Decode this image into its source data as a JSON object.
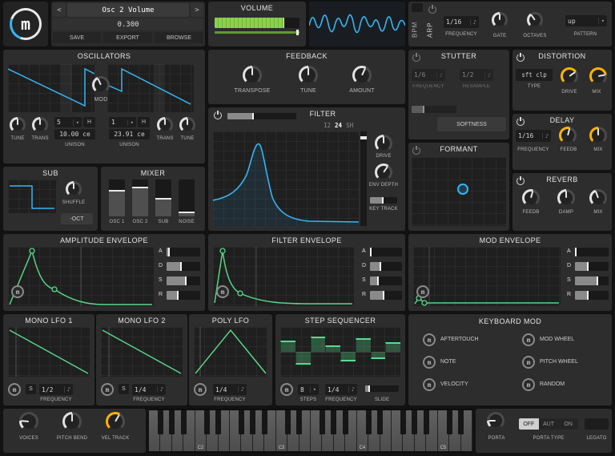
{
  "icons": {
    "helm": "m",
    "note": "♪",
    "caret": "▾",
    "prev": "<",
    "next": ">"
  },
  "colors": {
    "blue": "#35b5f3",
    "green": "#56d689",
    "orange": "#ffb300"
  },
  "top": {
    "patch": {
      "name": "Osc 2 Volume",
      "value": "0.300",
      "save": "SAVE",
      "export": "EXPORT",
      "browse": "BROWSE"
    },
    "volume_label": "VOLUME",
    "volume_fill": 0.82,
    "bpm_label": "BPM",
    "arp": {
      "label": "ARP",
      "frequency_value": "1/16",
      "frequency_label": "FREQUENCY",
      "gate_label": "GATE",
      "octaves_label": "OCTAVES",
      "pattern_value": "up",
      "pattern_label": "PATTERN"
    }
  },
  "oscillators": {
    "title": "OSCILLATORS",
    "mod_label": "MOD",
    "tune_label": "TUNE",
    "trans_label": "TRANS",
    "unison_label": "UNISON",
    "harm_label": "H",
    "osc1_voices": "5",
    "osc1_detune": "10.00 ce",
    "osc2_voices": "1",
    "osc2_detune": "23.91 ce"
  },
  "sub": {
    "title": "SUB",
    "shuffle_label": "SHUFFLE",
    "oct_label": "-OCT"
  },
  "mixer": {
    "title": "MIXER",
    "labels": [
      "OSC 1",
      "OSC 2",
      "SUB",
      "NOISE"
    ],
    "values": [
      0.72,
      0.8,
      0.5,
      0.12
    ]
  },
  "feedback": {
    "title": "FEEDBACK",
    "transpose_label": "TRANSPOSE",
    "tune_label": "TUNE",
    "amount_label": "AMOUNT"
  },
  "filter": {
    "title": "FILTER",
    "slider_fill": 0.38,
    "pole12": "12",
    "pole24": "24",
    "shelf": "SH",
    "drive_label": "DRIVE",
    "env_depth_label": "ENV DEPTH",
    "key_track_label": "KEY TRACK",
    "key_track_fill": 0.5
  },
  "stutter": {
    "title": "STUTTER",
    "frequency_value": "1/6",
    "frequency_label": "FREQUENCY",
    "resample_value": "1/2",
    "resample_label": "RESAMPLE",
    "softness_label": "SOFTNESS",
    "slider_fill": 0.28
  },
  "formant": {
    "title": "FORMANT"
  },
  "distortion": {
    "title": "DISTORTION",
    "type_value": "sft clp",
    "type_label": "TYPE",
    "drive_label": "DRIVE",
    "mix_label": "MIX"
  },
  "delay": {
    "title": "DELAY",
    "frequency_value": "1/16",
    "frequency_label": "FREQUENCY",
    "feedback_label": "FEEDB",
    "mix_label": "MIX"
  },
  "reverb": {
    "title": "REVERB",
    "feedback_label": "FEEDB",
    "damp_label": "DAMP",
    "mix_label": "MIX"
  },
  "adsr_letters": [
    "A",
    "D",
    "S",
    "R"
  ],
  "amp_env": {
    "title": "AMPLITUDE ENVELOPE",
    "adsr": [
      0.1,
      0.45,
      0.6,
      0.35
    ]
  },
  "filter_env": {
    "title": "FILTER ENVELOPE",
    "adsr": [
      0.06,
      0.35,
      0.28,
      0.45
    ]
  },
  "mod_env": {
    "title": "MOD ENVELOPE",
    "adsr": [
      0.04,
      0.4,
      0.7,
      0.4
    ]
  },
  "lfo1": {
    "title": "MONO LFO 1",
    "sync_label": "S",
    "frequency_value": "1/2",
    "frequency_label": "FREQUENCY"
  },
  "lfo2": {
    "title": "MONO LFO 2",
    "sync_label": "S",
    "frequency_value": "1/4",
    "frequency_label": "FREQUENCY"
  },
  "poly_lfo": {
    "title": "POLY LFO",
    "frequency_value": "1/4",
    "frequency_label": "FREQUENCY"
  },
  "step_sequencer": {
    "title": "STEP SEQUENCER",
    "steps_value": "8",
    "steps_label": "STEPS",
    "frequency_value": "1/4",
    "frequency_label": "FREQUENCY",
    "slide_label": "SLIDE",
    "slide_fill": 0.15,
    "values": [
      0.45,
      -0.5,
      0.62,
      0.25,
      -0.4,
      0.55,
      -0.28,
      0.4
    ]
  },
  "keyboard_mod": {
    "title": "KEYBOARD MOD",
    "items": [
      "AFTERTOUCH",
      "MOD WHEEL",
      "NOTE",
      "PITCH WHEEL",
      "VELOCITY",
      "RANDOM"
    ]
  },
  "bottom": {
    "voices_label": "VOICES",
    "pitch_bend_label": "PITCH BEND",
    "vel_track_label": "VEL TRACK",
    "octave_labels": [
      "C2",
      "C3",
      "C4",
      "C5"
    ],
    "porta_label": "PORTA",
    "porta_off": "OFF",
    "porta_aut": "AUT",
    "porta_on": "ON",
    "porta_type_label": "PORTA TYPE",
    "legato_label": "LEGATO"
  }
}
